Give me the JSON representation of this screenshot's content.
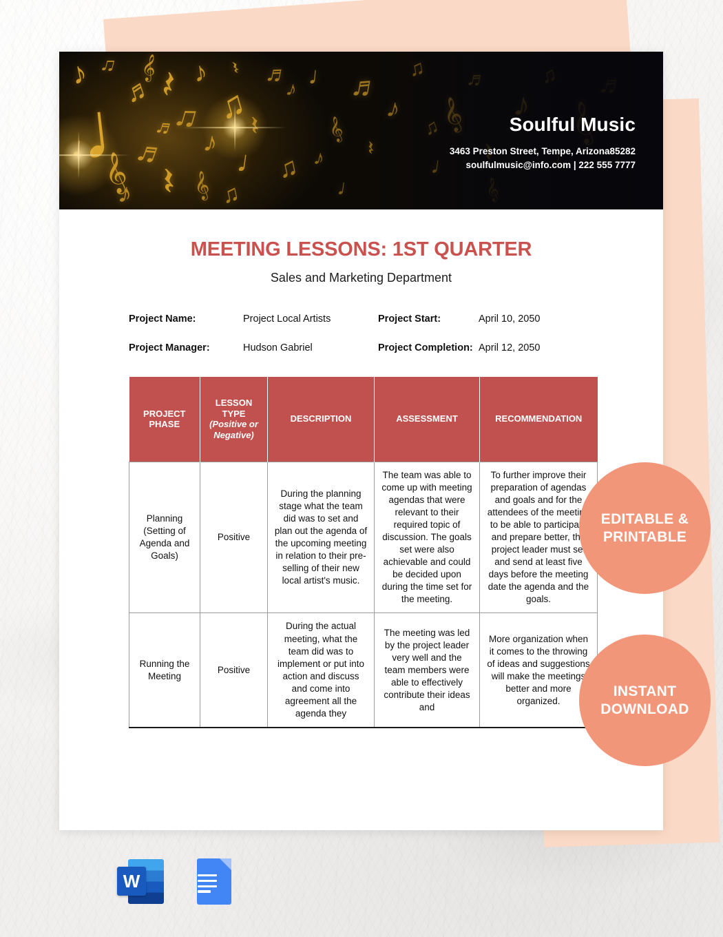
{
  "letterhead": {
    "company_name": "Soulful Music",
    "address": "3463 Preston Street, Tempe, Arizona85282",
    "contact": "soulfulmusic@info.com | 222 555 7777",
    "background_icon": "musical-notes-banner"
  },
  "document": {
    "title": "MEETING LESSONS: 1ST QUARTER",
    "subtitle": "Sales and Marketing Department",
    "title_color": "#c9524e"
  },
  "meta": {
    "project_name_label": "Project Name:",
    "project_name_value": "Project Local Artists",
    "project_start_label": "Project Start:",
    "project_start_value": "April 10, 2050",
    "project_manager_label": "Project Manager:",
    "project_manager_value": "Hudson Gabriel",
    "project_completion_label": "Project Completion:",
    "project_completion_value": "April 12, 2050"
  },
  "table": {
    "header_color": "#c0514f",
    "columns": [
      {
        "label": "PROJECT PHASE",
        "sub": ""
      },
      {
        "label": "LESSON TYPE",
        "sub": "(Positive or Negative)"
      },
      {
        "label": "DESCRIPTION",
        "sub": ""
      },
      {
        "label": "ASSESSMENT",
        "sub": ""
      },
      {
        "label": "RECOMMENDATION",
        "sub": ""
      }
    ],
    "rows": [
      {
        "phase": "Planning (Setting of Agenda and Goals)",
        "type": "Positive",
        "description": "During the planning stage what the team did was to set and plan out the agenda of the upcoming meeting in relation to their pre-selling of their new local artist's music.",
        "assessment": "The team was able to come up with meeting agendas that were relevant to their required topic of discussion. The goals set were also achievable and could be decided upon during the time set for the meeting.",
        "recommendation": "To further improve their preparation of agendas and goals and for the attendees of the meeting to be able to participate and prepare better, the project leader must set and send at least five days before the meeting date the agenda and the goals."
      },
      {
        "phase": "Running the Meeting",
        "type": "Positive",
        "description": "During the actual meeting, what the team did was to implement or put into action and discuss and come into agreement all the agenda they",
        "assessment": "The meeting was led by the project leader very well and the team members were able to effectively contribute their ideas and",
        "recommendation": "More organization when it comes to the throwing of ideas and suggestions will make the meetings better and more organized."
      }
    ]
  },
  "badges": {
    "color": "#f2967a",
    "editable": "EDITABLE & PRINTABLE",
    "instant": "INSTANT DOWNLOAD"
  },
  "formats": [
    {
      "name": "microsoft-word",
      "glyph": "W"
    },
    {
      "name": "google-docs",
      "glyph": ""
    }
  ]
}
